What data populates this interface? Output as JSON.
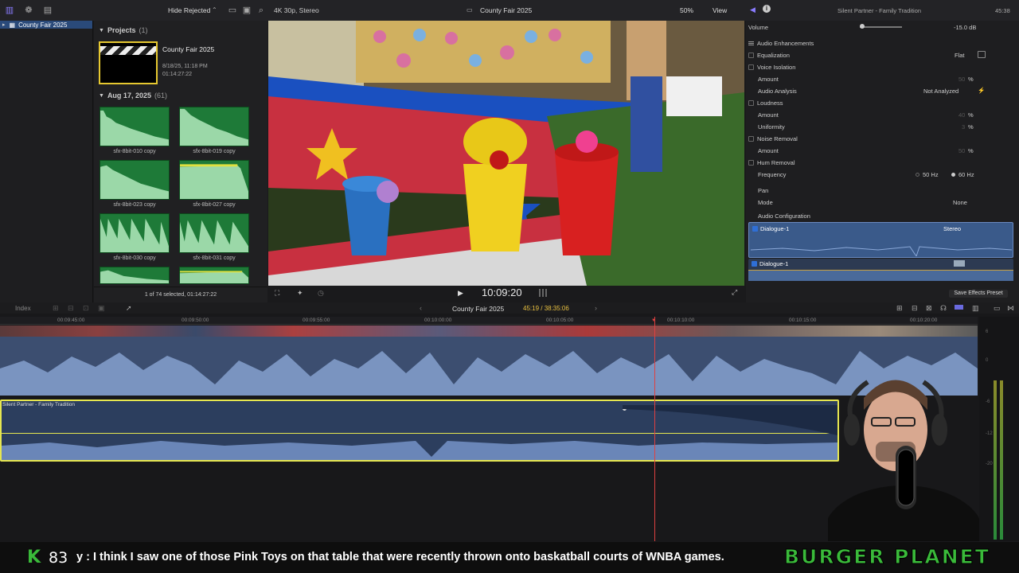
{
  "toolbar": {
    "filter": "Hide Rejected",
    "format": "4K 30p, Stereo",
    "project_title": "County Fair 2025",
    "zoom": "50%",
    "view": "View",
    "inspector_title": "Silent Partner - Family Tradition",
    "inspector_time": "45:38"
  },
  "library": {
    "item": "County Fair 2025"
  },
  "browser": {
    "projects_label": "Projects",
    "projects_count": "(1)",
    "project_name": "County Fair 2025",
    "project_date": "8/18/25, 11:18 PM",
    "project_duration": "01:14:27:22",
    "date_group": "Aug 17, 2025",
    "date_count": "(61)",
    "clips": [
      "sfx-8bit-010 copy",
      "sfx-8bit-019 copy",
      "sfx-8bit-023 copy",
      "sfx-8bit-027 copy",
      "sfx-8bit-030 copy",
      "sfx-8bit-031 copy"
    ],
    "status": "1 of 74 selected, 01:14:27:22"
  },
  "viewer": {
    "timecode": "10:09:20"
  },
  "inspector": {
    "volume_label": "Volume",
    "volume_value": "-15.0 dB",
    "enh_header": "Audio Enhancements",
    "eq_label": "Equalization",
    "eq_value": "Flat",
    "voice_iso": "Voice Isolation",
    "amount1": "Amount",
    "amount1_val": "50",
    "pct": "%",
    "analysis_label": "Audio Analysis",
    "analysis_value": "Not Analyzed",
    "loudness": "Loudness",
    "amount2": "Amount",
    "amount2_val": "40",
    "uniformity": "Uniformity",
    "uniformity_val": "3",
    "noise": "Noise Removal",
    "amount3": "Amount",
    "amount3_val": "50",
    "hum": "Hum Removal",
    "frequency": "Frequency",
    "hz50": "50 Hz",
    "hz60": "60 Hz",
    "pan_header": "Pan",
    "mode_label": "Mode",
    "mode_value": "None",
    "config_header": "Audio Configuration",
    "dlg1": "Dialogue-1",
    "dlg1_mode": "Stereo",
    "dlg2": "Dialogue-1",
    "preset_button": "Save Effects Preset"
  },
  "timeline": {
    "index": "Index",
    "title": "County Fair 2025",
    "duration": "45:19 / 38:35:06",
    "ruler": [
      "00:09:45:00",
      "00:09:50:00",
      "00:09:55:00",
      "00:10:00:00",
      "00:10:05:00",
      "00:10:10:00",
      "00:10:15:00",
      "00:10:20:00"
    ],
    "clip_label": "Silent Partner - Family Tradition",
    "meter_labels": [
      "6",
      "0",
      "-6",
      "-12",
      "-20"
    ]
  },
  "subtitle": {
    "k_badge": "K",
    "count": "83",
    "text": "y : I think I saw one of those Pink Toys on that table that were recently thrown onto baskatball courts of WNBA games.",
    "brand": "BURGER PLANET"
  },
  "colors": {
    "accent": "#2f6fd6",
    "clip_green": "#1e7a38",
    "selection_yellow": "#e6e650",
    "audio_blue": "#5b7aa8"
  }
}
